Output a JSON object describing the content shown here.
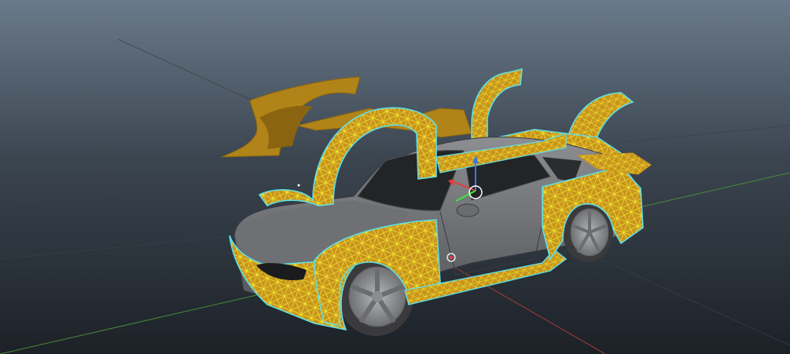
{
  "viewport": {
    "background_top": "#6a7a8a",
    "background_bottom": "#1c2127"
  },
  "colors": {
    "grid_line": "#3a4048",
    "axis_x": "#a83a3a",
    "axis_y": "#4a8a3a",
    "body_paint": "#7a7c80",
    "body_dark": "#55575b",
    "glass": "#222426",
    "wheel": "#9a9c9e",
    "tire": "#3a3a3c",
    "kit_fill": "#c8941e",
    "kit_dark": "#8a6410",
    "wire_yellow": "#f2ea30",
    "wire_cyan": "#5fe0e6",
    "gizmo_blue": "#3a78e8",
    "gizmo_red": "#e83a3a",
    "gizmo_green": "#3ae83a"
  },
  "objects": [
    {
      "name": "car-body",
      "label": ""
    },
    {
      "name": "bodykit",
      "label": ""
    }
  ],
  "icons": [
    "transform-gizmo-icon",
    "pivot-point-icon",
    "origin-point-icon"
  ]
}
